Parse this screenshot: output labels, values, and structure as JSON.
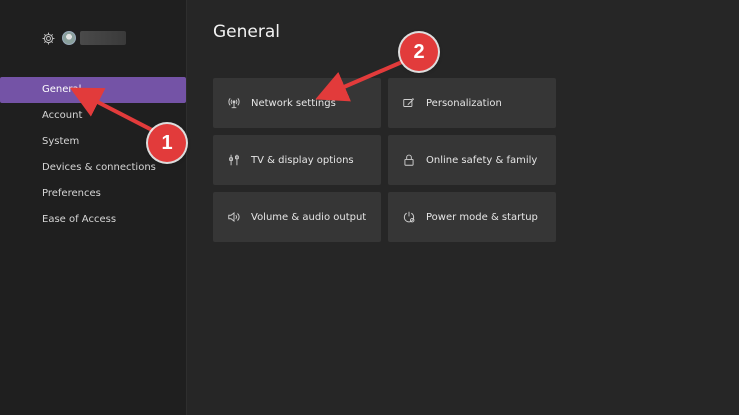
{
  "colors": {
    "sidebar_bg": "#1f1f1f",
    "main_bg": "#262626",
    "active_accent": "#7453a6",
    "tile_bg": "#363636",
    "annotation_red": "#e23b3b"
  },
  "profile": {
    "gear_icon": "gear-icon",
    "avatar": "avatar"
  },
  "sidebar": {
    "items": [
      {
        "label": "General",
        "active": true
      },
      {
        "label": "Account",
        "active": false
      },
      {
        "label": "System",
        "active": false
      },
      {
        "label": "Devices & connections",
        "active": false
      },
      {
        "label": "Preferences",
        "active": false
      },
      {
        "label": "Ease of Access",
        "active": false
      }
    ]
  },
  "main": {
    "title": "General",
    "tiles": [
      {
        "label": "Network settings",
        "icon": "network-icon"
      },
      {
        "label": "Personalization",
        "icon": "personalization-icon"
      },
      {
        "label": "TV & display options",
        "icon": "tv-display-icon"
      },
      {
        "label": "Online safety & family",
        "icon": "lock-icon"
      },
      {
        "label": "Volume & audio output",
        "icon": "speaker-icon"
      },
      {
        "label": "Power mode & startup",
        "icon": "power-icon"
      }
    ]
  },
  "annotations": [
    {
      "number": "1"
    },
    {
      "number": "2"
    }
  ]
}
